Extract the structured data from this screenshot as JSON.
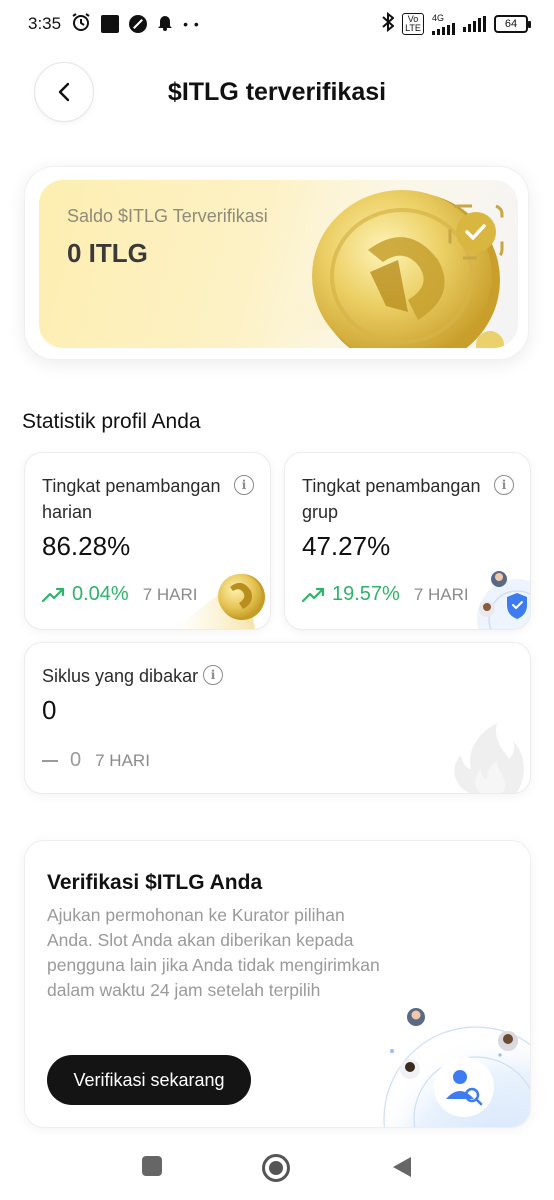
{
  "status_bar": {
    "time": "3:35",
    "network_type": "4G",
    "volte_label": "Vo LTE",
    "battery": "64"
  },
  "header": {
    "title": "$ITLG terverifikasi"
  },
  "balance": {
    "label": "Saldo $ITLG Terverifikasi",
    "value": "0 ITLG"
  },
  "stats": {
    "section_title": "Statistik profil Anda",
    "daily": {
      "label": "Tingkat penambangan harian",
      "value": "86.28%",
      "trend": "0.04%",
      "period": "7 HARI"
    },
    "group": {
      "label": "Tingkat penambangan grup",
      "value": "47.27%",
      "trend": "19.57%",
      "period": "7 HARI"
    },
    "burned": {
      "label": "Siklus yang dibakar",
      "value": "0",
      "trend": "0",
      "period": "7 HARI"
    }
  },
  "verify": {
    "title": "Verifikasi $ITLG Anda",
    "description": "Ajukan permohonan ke Kurator pilihan Anda. Slot Anda akan diberikan kepada pengguna lain jika Anda tidak mengirimkan dalam waktu 24 jam setelah terpilih",
    "button_label": "Verifikasi sekarang"
  },
  "colors": {
    "positive_trend": "#2fb36b",
    "gold": "#e8c84a",
    "button_dark": "#141414",
    "accent_blue": "#3d7bf0"
  }
}
